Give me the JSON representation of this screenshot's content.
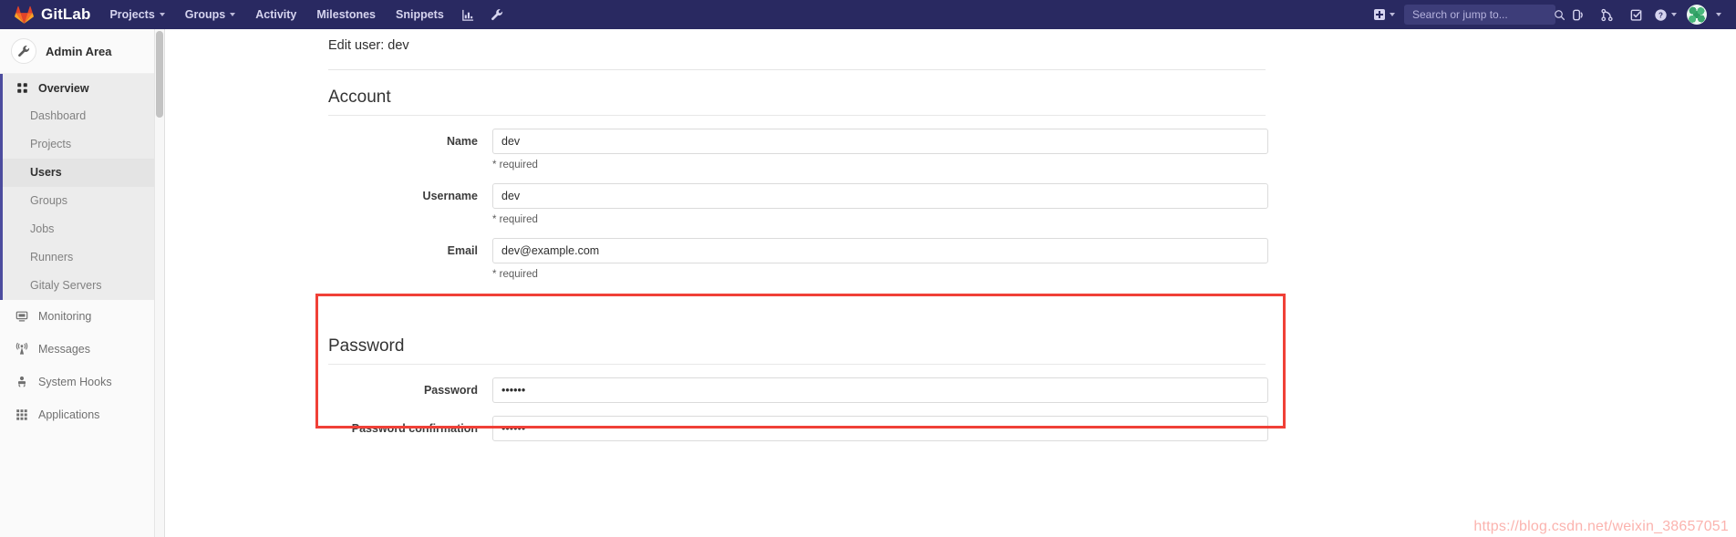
{
  "navbar": {
    "brand": "GitLab",
    "brand_logo_icon": "gitlab-tanuki-logo",
    "items": [
      {
        "label": "Projects",
        "icon": "chevron-down-icon",
        "has_caret": true
      },
      {
        "label": "Groups",
        "icon": "chevron-down-icon",
        "has_caret": true
      },
      {
        "label": "Activity",
        "has_caret": false
      },
      {
        "label": "Milestones",
        "has_caret": false
      },
      {
        "label": "Snippets",
        "has_caret": false
      }
    ],
    "icon_items": [
      {
        "name": "analytics-chart-icon"
      },
      {
        "name": "admin-wrench-icon"
      }
    ],
    "create_new_icon": "plus-square-icon",
    "search": {
      "placeholder": "Search or jump to...",
      "value": "",
      "icon": "search-icon"
    },
    "right_icons": [
      {
        "name": "issues-icon"
      },
      {
        "name": "merge-requests-icon"
      },
      {
        "name": "todos-icon"
      },
      {
        "name": "help-question-icon"
      }
    ],
    "avatar_icon": "user-avatar",
    "bg_color": "#292961"
  },
  "sidebar": {
    "context": {
      "title": "Admin Area",
      "icon": "wrench-icon"
    },
    "overview": {
      "label": "Overview",
      "icon": "overview-grid-icon",
      "items": [
        {
          "label": "Dashboard",
          "active": false
        },
        {
          "label": "Projects",
          "active": false
        },
        {
          "label": "Users",
          "active": true
        },
        {
          "label": "Groups",
          "active": false
        },
        {
          "label": "Jobs",
          "active": false
        },
        {
          "label": "Runners",
          "active": false
        },
        {
          "label": "Gitaly Servers",
          "active": false
        }
      ]
    },
    "others": [
      {
        "label": "Monitoring",
        "icon": "monitor-icon"
      },
      {
        "label": "Messages",
        "icon": "broadcast-messages-icon"
      },
      {
        "label": "System Hooks",
        "icon": "system-hooks-icon"
      },
      {
        "label": "Applications",
        "icon": "applications-grid-icon"
      }
    ]
  },
  "main": {
    "page_title": "Edit user: dev",
    "account": {
      "heading": "Account",
      "fields": [
        {
          "label": "Name",
          "value": "dev",
          "help": "* required",
          "type": "text"
        },
        {
          "label": "Username",
          "value": "dev",
          "help": "* required",
          "type": "text"
        },
        {
          "label": "Email",
          "value": "dev@example.com",
          "help": "* required",
          "type": "text"
        }
      ]
    },
    "password": {
      "heading": "Password",
      "highlighted": true,
      "highlight_color": "#f04037",
      "fields": [
        {
          "label": "Password",
          "value": "••••••",
          "type": "password"
        },
        {
          "label": "Password confirmation",
          "value": "••••••",
          "type": "password"
        }
      ]
    }
  },
  "watermark": {
    "text": "https://blog.csdn.net/weixin_38657051"
  }
}
